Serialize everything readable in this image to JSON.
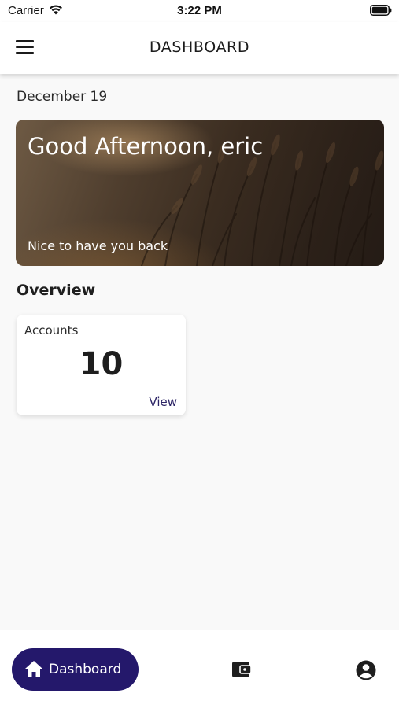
{
  "status_bar": {
    "carrier": "Carrier",
    "time": "3:22 PM",
    "icons": [
      "wifi-icon",
      "battery-icon"
    ]
  },
  "app_bar": {
    "title": "DASHBOARD",
    "menu_icon": "hamburger-menu-icon"
  },
  "date": "December 19",
  "greeting_card": {
    "title": "Good Afternoon, eric",
    "subtitle": "Nice to have you back"
  },
  "overview": {
    "title": "Overview",
    "cards": [
      {
        "label": "Accounts",
        "count": "10",
        "action": "View"
      }
    ]
  },
  "bottom_nav": {
    "items": [
      {
        "label": "Dashboard",
        "icon": "home-icon",
        "active": true
      },
      {
        "label": "",
        "icon": "wallet-icon",
        "active": false
      },
      {
        "label": "",
        "icon": "account-circle-icon",
        "active": false
      }
    ]
  },
  "colors": {
    "accent": "#24186b",
    "link": "#2c2466",
    "background": "#f9f9f9"
  }
}
